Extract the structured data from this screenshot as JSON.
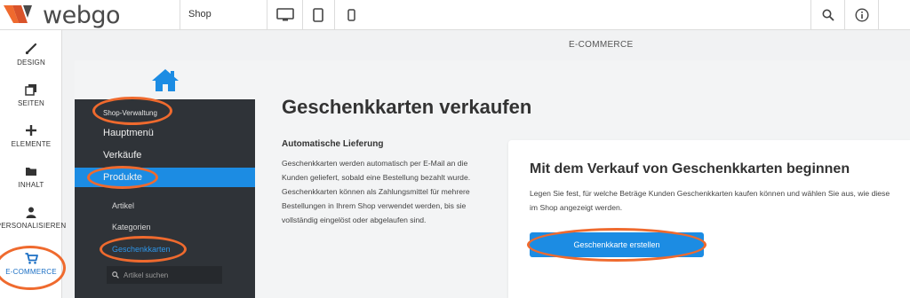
{
  "brand": {
    "name": "webgo"
  },
  "topbar": {
    "page_select": "Shop",
    "devices": [
      "desktop-icon",
      "tablet-icon",
      "mobile-icon"
    ],
    "actions": [
      "search-icon",
      "info-icon"
    ]
  },
  "sidebar": {
    "items": [
      {
        "label": "DESIGN",
        "icon": "brush-icon"
      },
      {
        "label": "SEITEN",
        "icon": "pages-icon"
      },
      {
        "label": "ELEMENTE",
        "icon": "plus-icon"
      },
      {
        "label": "INHALT",
        "icon": "folder-icon"
      },
      {
        "label": "PERSONALISIEREN",
        "icon": "person-icon"
      },
      {
        "label": "E-COMMERCE",
        "icon": "cart-icon",
        "active": true
      }
    ]
  },
  "header": {
    "section": "E-COMMERCE"
  },
  "shop_nav": {
    "heading": "Shop-Verwaltung",
    "items": [
      "Hauptmenü",
      "Verkäufe",
      "Produkte"
    ],
    "active": "Produkte",
    "sub_items": [
      "Artikel",
      "Kategorien",
      "Geschenkkarten"
    ],
    "highlighted_sub": "Geschenkkarten",
    "search_placeholder": "Artikel suchen"
  },
  "main": {
    "title": "Geschenkkarten verkaufen",
    "delivery_title": "Automatische Lieferung",
    "delivery_text": "Geschenkkarten werden automatisch per E-Mail an die Kunden geliefert, sobald eine Bestellung bezahlt wurde. Geschenkkarten können als Zahlungsmittel für mehrere Bestellungen in Ihrem Shop verwendet werden, bis sie vollständig eingelöst oder abgelaufen sind.",
    "card_title": "Mit dem Verkauf von Geschenkkarten beginnen",
    "card_text": "Legen Sie fest, für welche Beträge Kunden Geschenkkarten kaufen können und wählen Sie aus, wie diese im Shop angezeigt werden.",
    "cta_label": "Geschenkkarte erstellen"
  },
  "colors": {
    "accent": "#1c8ce3",
    "annotation": "#ef6a2e",
    "nav_bg": "#2f3338"
  }
}
